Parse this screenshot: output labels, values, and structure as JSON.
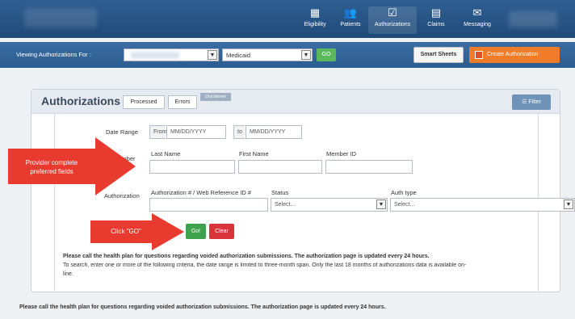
{
  "nav": {
    "items": [
      {
        "label": "Eligibility",
        "icon": "calendar-icon"
      },
      {
        "label": "Patients",
        "icon": "patients-icon"
      },
      {
        "label": "Authorizations",
        "icon": "authorizations-icon"
      },
      {
        "label": "Claims",
        "icon": "claims-icon"
      },
      {
        "label": "Messaging",
        "icon": "envelope-icon"
      }
    ],
    "active": "Authorizations"
  },
  "viewing": {
    "label": "Viewing Authorizations For :",
    "plan_value": "Medicaid",
    "go_label": "GO",
    "smart_sheets_label": "Smart Sheets",
    "create_label": "Create Authorization"
  },
  "panel": {
    "title": "Authorizations",
    "tabs": [
      "Processed",
      "Errors"
    ],
    "disclaimer_label": "Disclaimer",
    "filter_label": "Filter"
  },
  "form": {
    "date_range_label": "Date Range",
    "from_label": "From",
    "from_placeholder": "MM/DD/YYYY",
    "to_label": "to",
    "to_placeholder": "MM/DD/YYYY",
    "member_label": "Member",
    "last_name_label": "Last Name",
    "first_name_label": "First Name",
    "member_id_label": "Member ID",
    "authorization_label": "Authorization",
    "auth_number_label": "Authorization # / Web Reference ID #",
    "status_label": "Status",
    "status_value": "Select...",
    "auth_type_label": "Auth type",
    "auth_type_value": "Select...",
    "go_label": "Go!",
    "clear_label": "Clear"
  },
  "notes": {
    "line1": "Please call the health plan for questions regarding voided authorization submissions. The authorization page is updated every 24 hours.",
    "line2": "To search, enter one or more of the following criteria, the date range is limited to three-month span. Only the last 18 months of authorizations data is available on-",
    "line3": "line.",
    "footer": "Please call the health plan for questions regarding voided authorization submissions. The authorization page is updated every 24 hours."
  },
  "annotations": {
    "provider_callout_line1": "Provider complete",
    "provider_callout_line2": "preferred fields",
    "go_callout": "Click \"GO\""
  },
  "colors": {
    "nav_bg": "#1f4a78",
    "create_btn": "#f07c2a",
    "go_green": "#3fa34d",
    "clear_red": "#d9343a",
    "callout_red": "#e83a2e"
  }
}
